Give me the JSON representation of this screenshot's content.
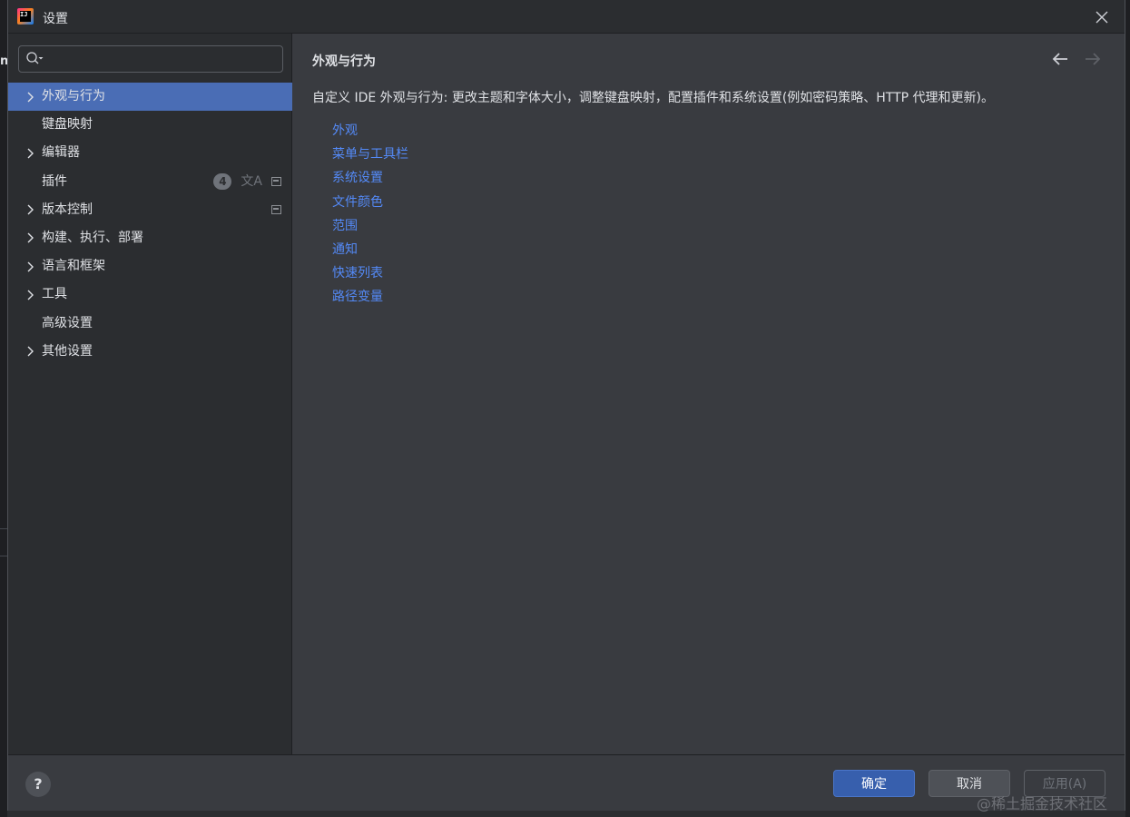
{
  "window": {
    "title": "设置",
    "icon": "intellij-idea-icon"
  },
  "search": {
    "placeholder": "",
    "value": ""
  },
  "sidebar": {
    "items": [
      {
        "label": "外观与行为",
        "expandable": true,
        "selected": true
      },
      {
        "label": "键盘映射",
        "expandable": false
      },
      {
        "label": "编辑器",
        "expandable": true
      },
      {
        "label": "插件",
        "expandable": false,
        "badge": "4",
        "icons": [
          "translate-icon",
          "project-settings-icon"
        ]
      },
      {
        "label": "版本控制",
        "expandable": true,
        "icons": [
          "project-settings-icon"
        ]
      },
      {
        "label": "构建、执行、部署",
        "expandable": true
      },
      {
        "label": "语言和框架",
        "expandable": true
      },
      {
        "label": "工具",
        "expandable": true
      },
      {
        "label": "高级设置",
        "expandable": false
      },
      {
        "label": "其他设置",
        "expandable": true
      }
    ]
  },
  "content": {
    "title": "外观与行为",
    "description": "自定义 IDE 外观与行为: 更改主题和字体大小，调整键盘映射，配置插件和系统设置(例如密码策略、HTTP 代理和更新)。",
    "links": [
      "外观",
      "菜单与工具栏",
      "系统设置",
      "文件颜色",
      "范围",
      "通知",
      "快速列表",
      "路径变量"
    ]
  },
  "footer": {
    "help_label": "?",
    "ok_label": "确定",
    "cancel_label": "取消",
    "apply_label": "应用(A)"
  },
  "background": {
    "left_letter": "n"
  },
  "watermark": "@稀土掘金技术社区",
  "colors": {
    "selection": "#4a6db5",
    "link": "#548af7",
    "dialog_bg": "#393b40",
    "sidebar_bg": "#2b2d30",
    "primary_button": "#375fad"
  }
}
